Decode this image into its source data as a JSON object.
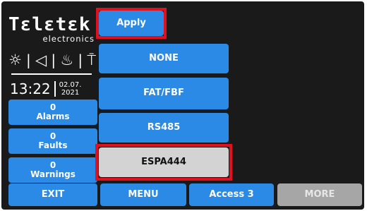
{
  "brand": {
    "name": "Tɛlɛtɛk",
    "sub": "electronics"
  },
  "status_icons": [
    {
      "name": "sun-icon",
      "glyph": "☼"
    },
    {
      "name": "speaker-icon",
      "glyph": "◁"
    },
    {
      "name": "flame-icon",
      "glyph": "♨"
    },
    {
      "name": "extinguisher-icon",
      "glyph": "⍑"
    }
  ],
  "clock": {
    "time": "13:22",
    "date_line1": "02.07.",
    "date_line2": "2021"
  },
  "counters": [
    {
      "count": "0",
      "label": "Alarms"
    },
    {
      "count": "0",
      "label": "Faults"
    },
    {
      "count": "0",
      "label": "Warnings"
    }
  ],
  "apply_label": "Apply",
  "options": [
    {
      "label": "NONE",
      "selected": false
    },
    {
      "label": "FAT/FBF",
      "selected": false
    },
    {
      "label": "RS485",
      "selected": false
    },
    {
      "label": "ESPA444",
      "selected": true
    }
  ],
  "bottom_bar": {
    "exit": "EXIT",
    "menu": "MENU",
    "access": "Access 3",
    "more": "MORE"
  },
  "colors": {
    "button": "#2a8ae6",
    "selected": "#d3d3d3",
    "highlight": "#e0101e",
    "background": "#1a1a1a",
    "disabled": "#a6a6a6"
  }
}
